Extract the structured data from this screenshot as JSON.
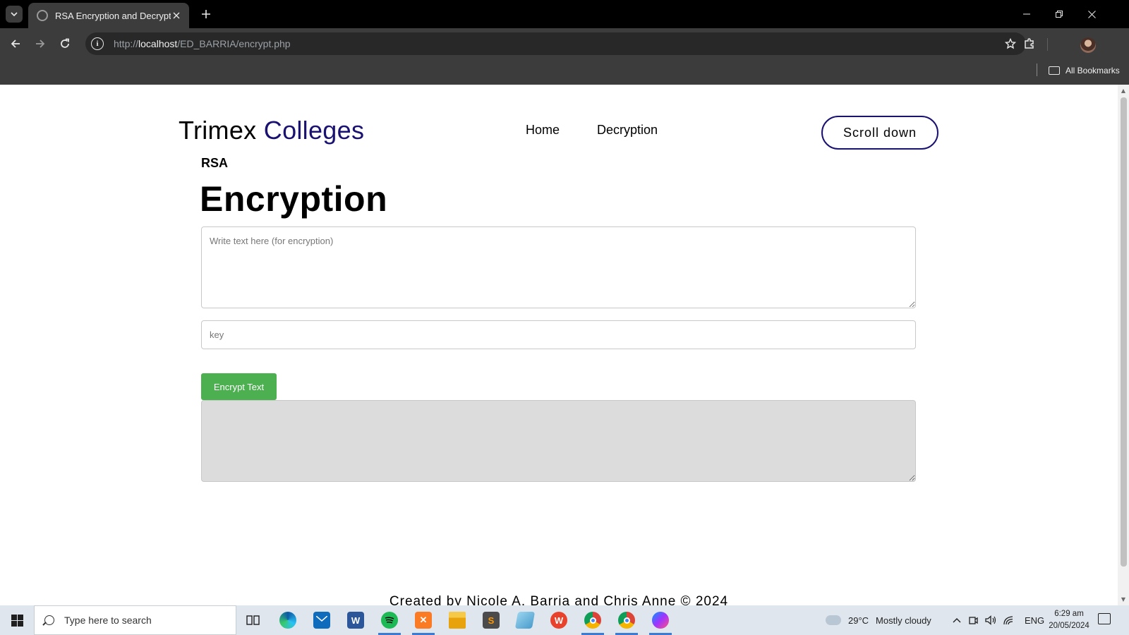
{
  "browser": {
    "tab_title": "RSA Encryption and Decryption",
    "url_scheme": "http://",
    "url_host": "localhost",
    "url_path": "/ED_BARRIA/encrypt.php",
    "all_bookmarks_label": "All Bookmarks"
  },
  "page": {
    "brand_main": "Trimex",
    "brand_accent": "Colleges",
    "nav": [
      {
        "label": "Home"
      },
      {
        "label": "Decryption"
      }
    ],
    "scroll_button_label": "Scroll down",
    "kicker": "RSA",
    "heading": "Encryption",
    "text_input_placeholder": "Write text here (for encryption)",
    "key_input_placeholder": "key",
    "encrypt_button_label": "Encrypt Text",
    "output_value": "",
    "footer": "Created by Nicole A. Barria and Chris Anne © 2024"
  },
  "taskbar": {
    "search_placeholder": "Type here to search",
    "weather_temp": "29°C",
    "weather_text": "Mostly cloudy",
    "language": "ENG",
    "time": "6:29 am",
    "date": "20/05/2024"
  },
  "colors": {
    "brand_accent": "#1a1270",
    "encrypt_button": "#4caf50",
    "output_bg": "#dcdcdc"
  }
}
